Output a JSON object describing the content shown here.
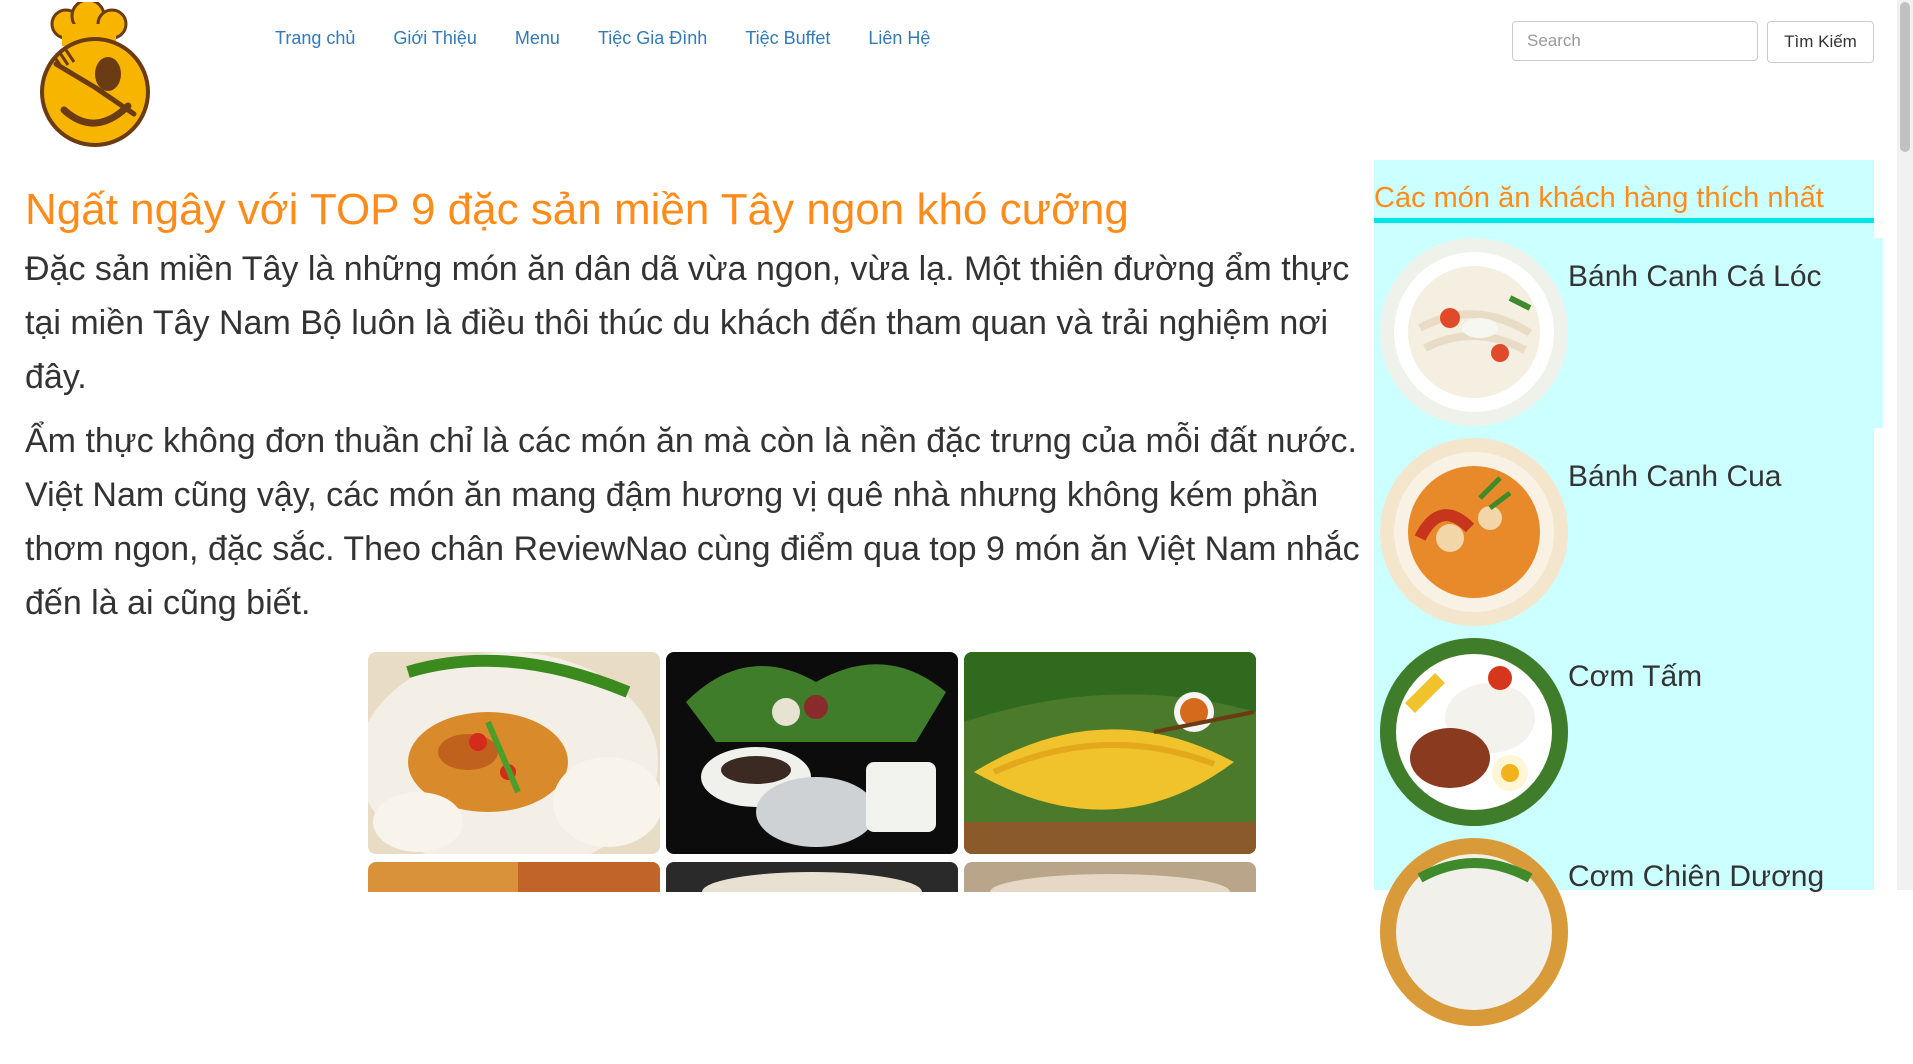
{
  "header": {
    "logo_icon": "chef-hat-fork-spoon-logo",
    "nav": [
      "Trang chủ",
      "Giới Thiệu",
      "Menu",
      "Tiệc Gia Đình",
      "Tiệc Buffet",
      "Liên Hệ"
    ],
    "search_placeholder": "Search",
    "search_button": "Tìm Kiếm"
  },
  "article": {
    "title": "Ngất ngây với TOP 9 đặc sản miền Tây ngon khó cưỡng",
    "paragraph1": "Đặc sản miền Tây là những món ăn dân dã vừa ngon, vừa lạ. Một thiên đường ẩm thực tại miền Tây Nam Bộ luôn là điều thôi thúc du khách đến tham quan và trải nghiệm nơi đây.",
    "paragraph2": "Ẩm thực không đơn thuần chỉ là các món ăn mà còn là nền đặc trưng của mỗi đất nước. Việt Nam cũng vậy, các món ăn mang đậm hương vị quê nhà nhưng không kém phần thơm ngon, đặc sắc. Theo chân ReviewNao cùng điểm qua top 9 món ăn Việt Nam nhắc đến là ai cũng biết."
  },
  "sidebar": {
    "title": "Các món ăn khách hàng thích nhất",
    "dishes": [
      "Bánh Canh Cá Lóc",
      "Bánh Canh Cua",
      "Cơm Tấm",
      "Cơm Chiên Dương"
    ]
  },
  "colors": {
    "accent_orange": "#ff8c1a",
    "sidebar_bg": "#ccffff",
    "sidebar_rule": "#00e6e6",
    "link_blue": "#337ab7"
  }
}
